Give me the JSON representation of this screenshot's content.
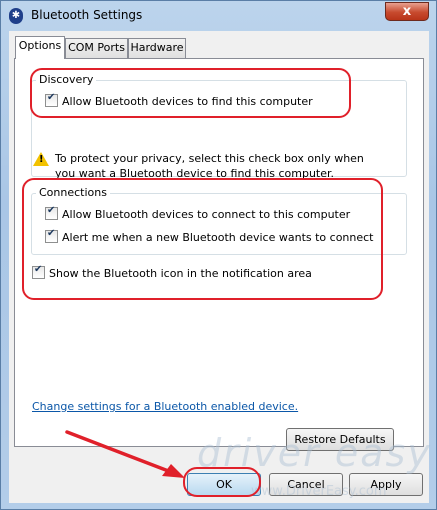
{
  "window": {
    "title": "Bluetooth Settings",
    "close_glyph": "x"
  },
  "tabs": [
    {
      "label": "Options"
    },
    {
      "label": "COM Ports"
    },
    {
      "label": "Hardware"
    }
  ],
  "discovery": {
    "label": "Discovery",
    "allow_find": {
      "label": "Allow Bluetooth devices to find this computer",
      "checked": true
    },
    "privacy_note": "To protect your privacy, select this check box only when you want a Bluetooth device to find this computer."
  },
  "connections": {
    "label": "Connections",
    "allow_connect": {
      "label": "Allow Bluetooth devices to connect to this computer",
      "checked": true
    },
    "alert_new": {
      "label": "Alert me when a new Bluetooth device wants to connect",
      "checked": true
    }
  },
  "show_icon": {
    "label": "Show the Bluetooth icon in the notification area",
    "checked": true
  },
  "change_link": "Change settings for a Bluetooth enabled device.",
  "restore_button": "Restore Defaults",
  "buttons": {
    "ok": "OK",
    "cancel": "Cancel",
    "apply": "Apply"
  },
  "watermark": {
    "brand": "driver easy",
    "url": "www.DriverEasy.com"
  },
  "colors": {
    "annotation_red": "#e0202a",
    "link_blue": "#0b57a8"
  }
}
